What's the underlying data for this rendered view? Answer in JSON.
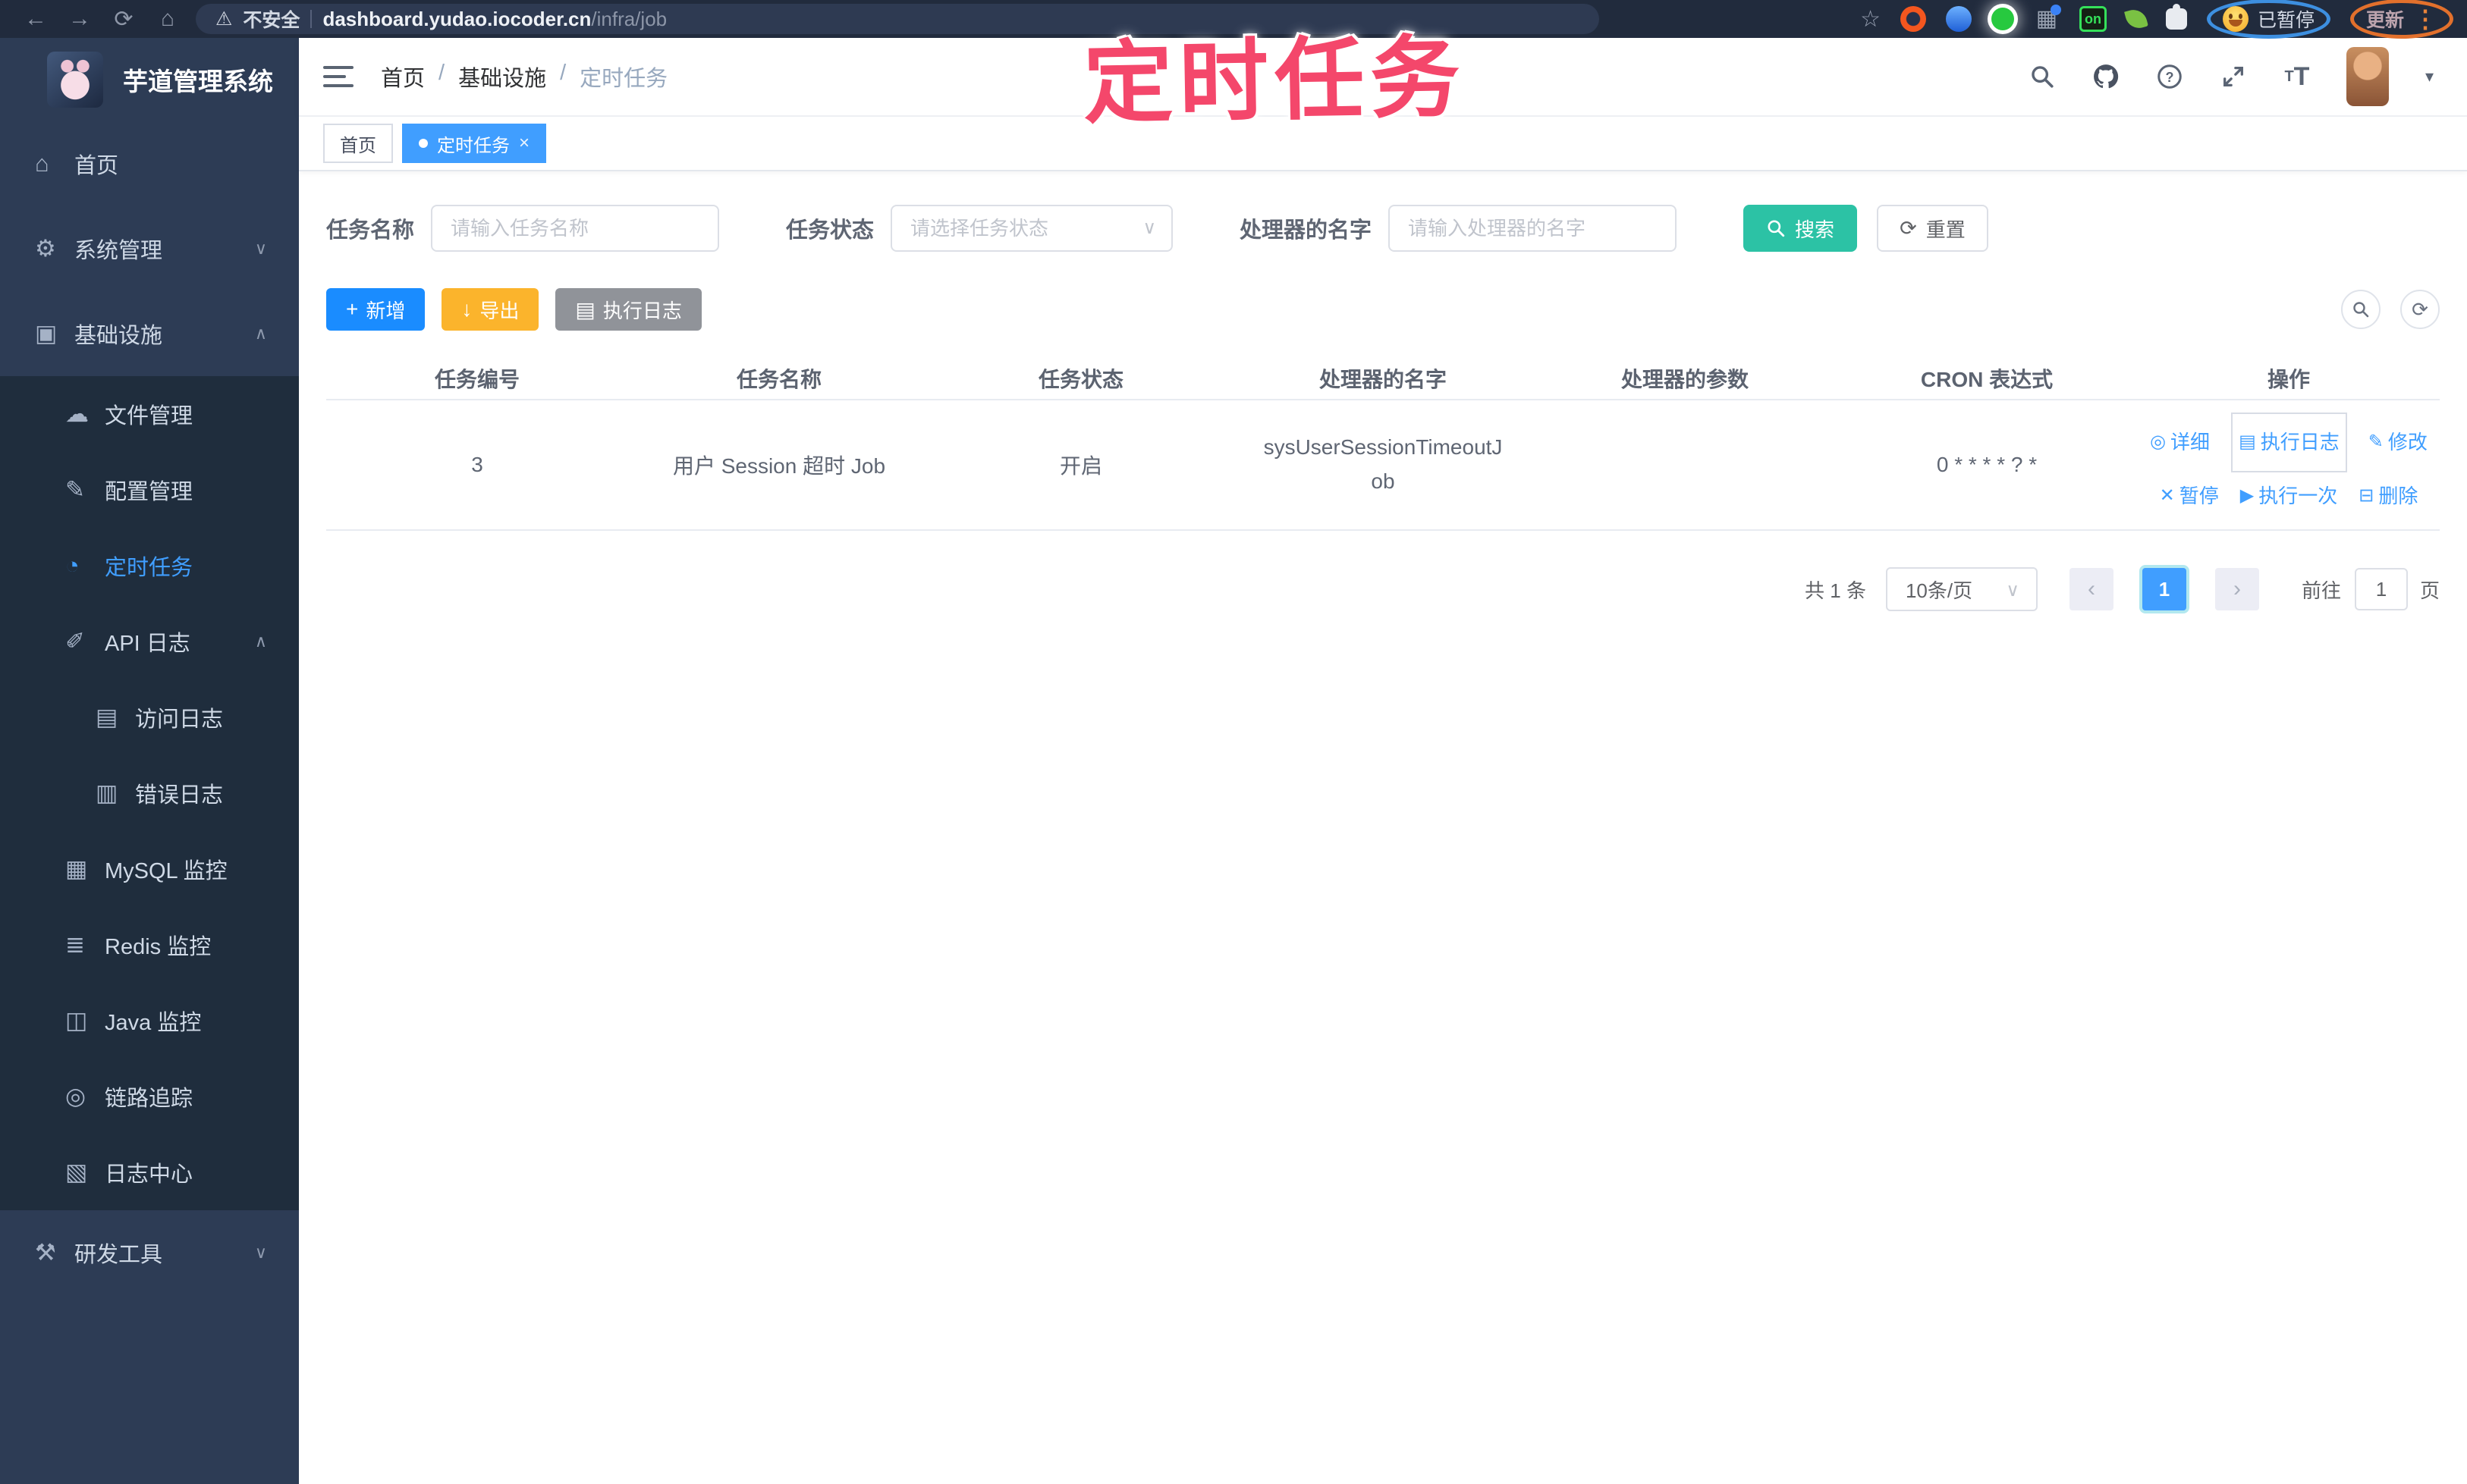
{
  "browser": {
    "security_label": "不安全",
    "url_host": "dashboard.yudao.iocoder.cn",
    "url_path": "/infra/job",
    "extension_badge": "on",
    "paused_label": "已暂停",
    "update_label": "更新"
  },
  "annotation": {
    "text": "定时任务",
    "color": "#f4476b"
  },
  "sidebar": {
    "title": "芋道管理系统",
    "items": [
      {
        "label": "首页",
        "glyph": "⌂"
      },
      {
        "label": "系统管理",
        "glyph": "⚙",
        "chevron": "∨"
      },
      {
        "label": "基础设施",
        "glyph": "▣",
        "chevron": "∧"
      },
      {
        "label": "文件管理",
        "glyph": "☁"
      },
      {
        "label": "配置管理",
        "glyph": "✎"
      },
      {
        "label": "定时任务",
        "glyph": "◔"
      },
      {
        "label": "API 日志",
        "glyph": "✐",
        "chevron": "∧"
      },
      {
        "label": "访问日志",
        "glyph": "▤"
      },
      {
        "label": "错误日志",
        "glyph": "▥"
      },
      {
        "label": "MySQL 监控",
        "glyph": "▦"
      },
      {
        "label": "Redis 监控",
        "glyph": "≣"
      },
      {
        "label": "Java 监控",
        "glyph": "◫"
      },
      {
        "label": "链路追踪",
        "glyph": "◎"
      },
      {
        "label": "日志中心",
        "glyph": "▧"
      },
      {
        "label": "研发工具",
        "glyph": "⚒",
        "chevron": "∨"
      }
    ]
  },
  "header": {
    "breadcrumb": [
      "首页",
      "基础设施",
      "定时任务"
    ],
    "separator": "/"
  },
  "tabs": [
    {
      "label": "首页"
    },
    {
      "label": "定时任务",
      "close": "×"
    }
  ],
  "filters": {
    "name_label": "任务名称",
    "name_placeholder": "请输入任务名称",
    "status_label": "任务状态",
    "status_placeholder": "请选择任务状态",
    "handler_label": "处理器的名字",
    "handler_placeholder": "请输入处理器的名字",
    "search_label": "搜索",
    "reset_label": "重置"
  },
  "toolbar": {
    "add_label": "新增",
    "export_label": "导出",
    "exec_log_label": "执行日志"
  },
  "table": {
    "columns": [
      "任务编号",
      "任务名称",
      "任务状态",
      "处理器的名字",
      "处理器的参数",
      "CRON 表达式",
      "操作"
    ],
    "row": {
      "id": "3",
      "name": "用户 Session 超时 Job",
      "status": "开启",
      "handler": "sysUserSessionTimeoutJob",
      "param": "",
      "cron": "0 * * * * ? *"
    },
    "actions": [
      {
        "label": "详细",
        "glyph": "◎"
      },
      {
        "label": "执行日志",
        "glyph": "▤"
      },
      {
        "label": "修改",
        "glyph": "✎"
      },
      {
        "label": "暂停",
        "glyph": "✕"
      },
      {
        "label": "执行一次",
        "glyph": "▶"
      },
      {
        "label": "删除",
        "glyph": "⊟"
      }
    ]
  },
  "pagination": {
    "total": "共 1 条",
    "page_size": "10条/页",
    "prev": "‹",
    "page": "1",
    "next": "›",
    "goto_label": "前往",
    "goto_value": "1",
    "unit_label": "页"
  },
  "colors": {
    "accent": "#409eff",
    "search_button": "#2cc2a5",
    "export_button": "#fbb42c",
    "info_button": "#909399",
    "sidebar_bg": "#2d3c55",
    "submenu_bg": "#1f2d3d",
    "annotation": "#f4476b"
  }
}
